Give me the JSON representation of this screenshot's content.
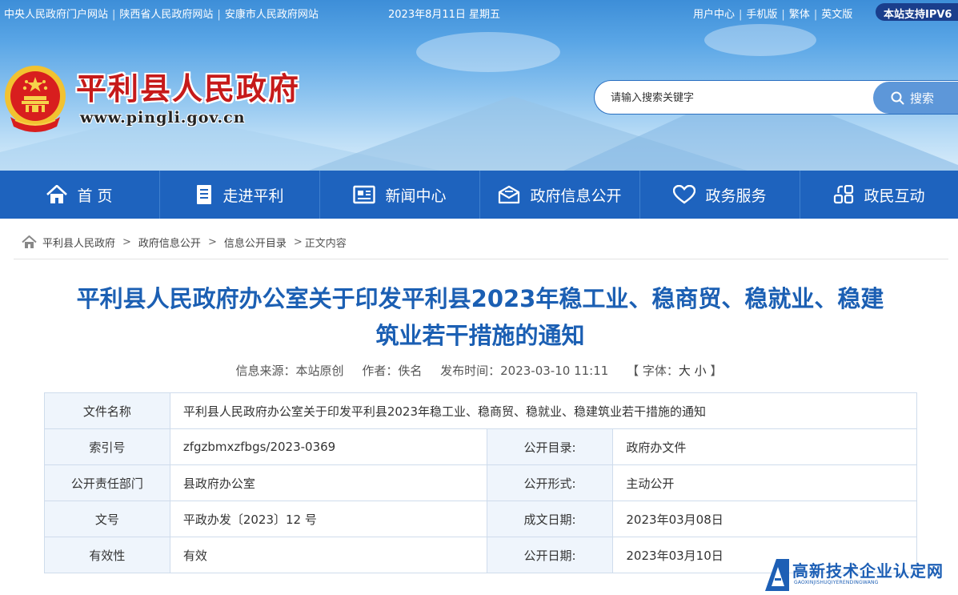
{
  "topbar": {
    "links": [
      "中央人民政府门户网站",
      "陕西省人民政府网站",
      "安康市人民政府网站"
    ],
    "date": "2023年8月11日 星期五",
    "right_links": [
      "用户中心",
      "手机版",
      "繁体",
      "英文版"
    ],
    "ipv6": "本站支持IPV6"
  },
  "header": {
    "site_title": "平利县人民政府",
    "site_url": "www.pingli.gov.cn",
    "search_placeholder": "请输入搜索关键字",
    "search_button": "搜索"
  },
  "nav": [
    {
      "label": "首 页",
      "icon": "home-icon"
    },
    {
      "label": "走进平利",
      "icon": "document-icon"
    },
    {
      "label": "新闻中心",
      "icon": "newspaper-icon"
    },
    {
      "label": "政府信息公开",
      "icon": "envelope-icon"
    },
    {
      "label": "政务服务",
      "icon": "heart-icon"
    },
    {
      "label": "政民互动",
      "icon": "interact-icon"
    }
  ],
  "breadcrumb": [
    "平利县人民政府",
    "政府信息公开",
    "信息公开目录",
    "正文内容"
  ],
  "article": {
    "title_line1": "平利县人民政府办公室关于印发平利县2023年稳工业、稳商贸、稳就业、稳建",
    "title_line2": "筑业若干措施的通知",
    "source": "信息来源：本站原创",
    "author": "作者：佚名",
    "publish_time": "发布时间：2023-03-10 11:11",
    "font_label": "【 字体：",
    "font_big": "大",
    "font_small": "小",
    "font_end": "】"
  },
  "info_table": {
    "file_name_label": "文件名称",
    "file_name": "平利县人民政府办公室关于印发平利县2023年稳工业、稳商贸、稳就业、稳建筑业若干措施的通知",
    "rows": [
      {
        "l1": "索引号",
        "v1": "zfgzbmxzfbgs/2023-0369",
        "l2": "公开目录:",
        "v2": "政府办文件"
      },
      {
        "l1": "公开责任部门",
        "v1": "县政府办公室",
        "l2": "公开形式:",
        "v2": "主动公开"
      },
      {
        "l1": "文号",
        "v1": "平政办发〔2023〕12 号",
        "l2": "成文日期:",
        "v2": "2023年03月08日"
      },
      {
        "l1": "有效性",
        "v1": "有效",
        "l2": "公开日期:",
        "v2": "2023年03月10日"
      }
    ]
  },
  "watermark": {
    "text": "高新技术企业认定网",
    "sub": "GAOXINJISHUQIYERENDINGWANG"
  },
  "colors": {
    "nav_bg": "#1e63be",
    "title_blue": "#1b5fb3",
    "site_title_red": "#c61a1a"
  }
}
